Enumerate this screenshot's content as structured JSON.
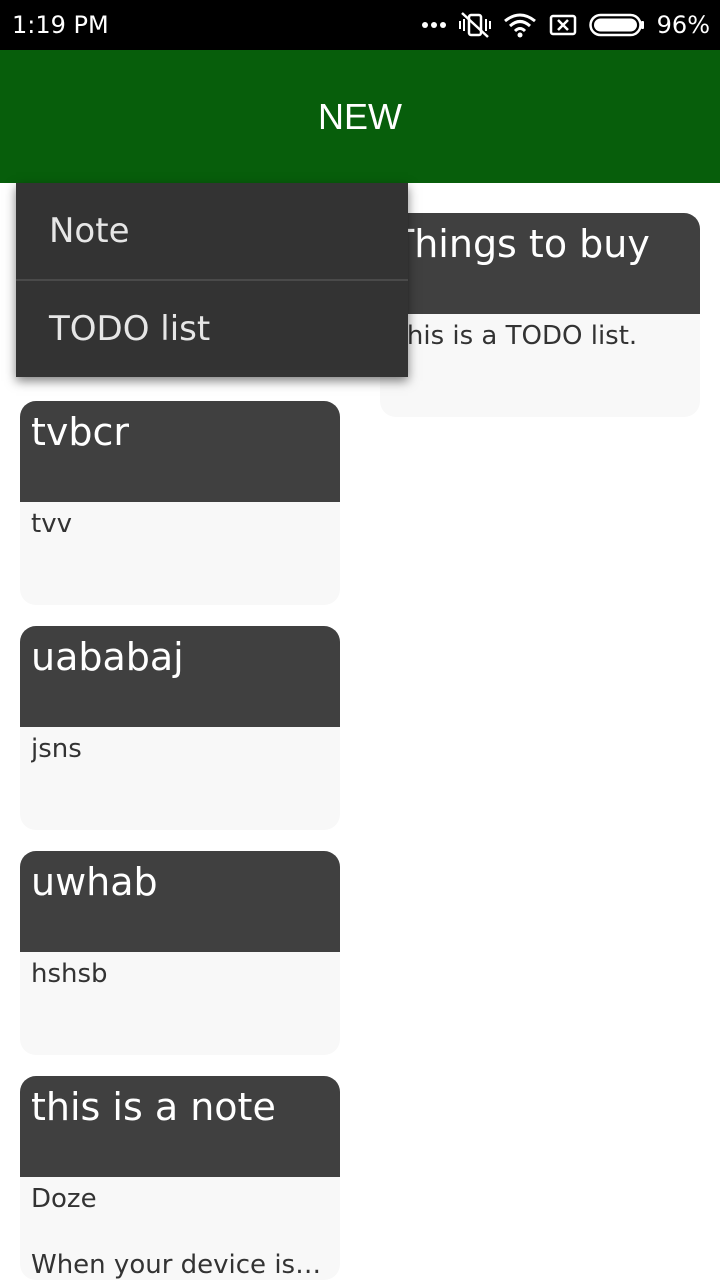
{
  "status_bar": {
    "time": "1:19 PM",
    "battery": "96%",
    "icons": [
      "more-dots-icon",
      "silent-vibrate-icon",
      "wifi-icon",
      "no-sim-icon",
      "battery-icon"
    ]
  },
  "app_bar": {
    "title": "NEW"
  },
  "popup_menu": {
    "items": [
      {
        "label": "Note"
      },
      {
        "label": "TODO list"
      }
    ]
  },
  "cards": [
    {
      "title": "Things to buy",
      "body": [
        "This is a TODO list."
      ]
    },
    {
      "title": "tvbcr",
      "body": [
        "tvv"
      ]
    },
    {
      "title": "uababaj",
      "body": [
        "jsns"
      ]
    },
    {
      "title": "uwhab",
      "body": [
        "hshsb"
      ]
    },
    {
      "title": "this is a note",
      "body": [
        "Doze",
        "When your device is a..."
      ]
    }
  ],
  "colors": {
    "app_bar": "#075e0b",
    "card_header": "#404040",
    "card_body": "#f8f8f8",
    "menu_bg": "#333333"
  }
}
